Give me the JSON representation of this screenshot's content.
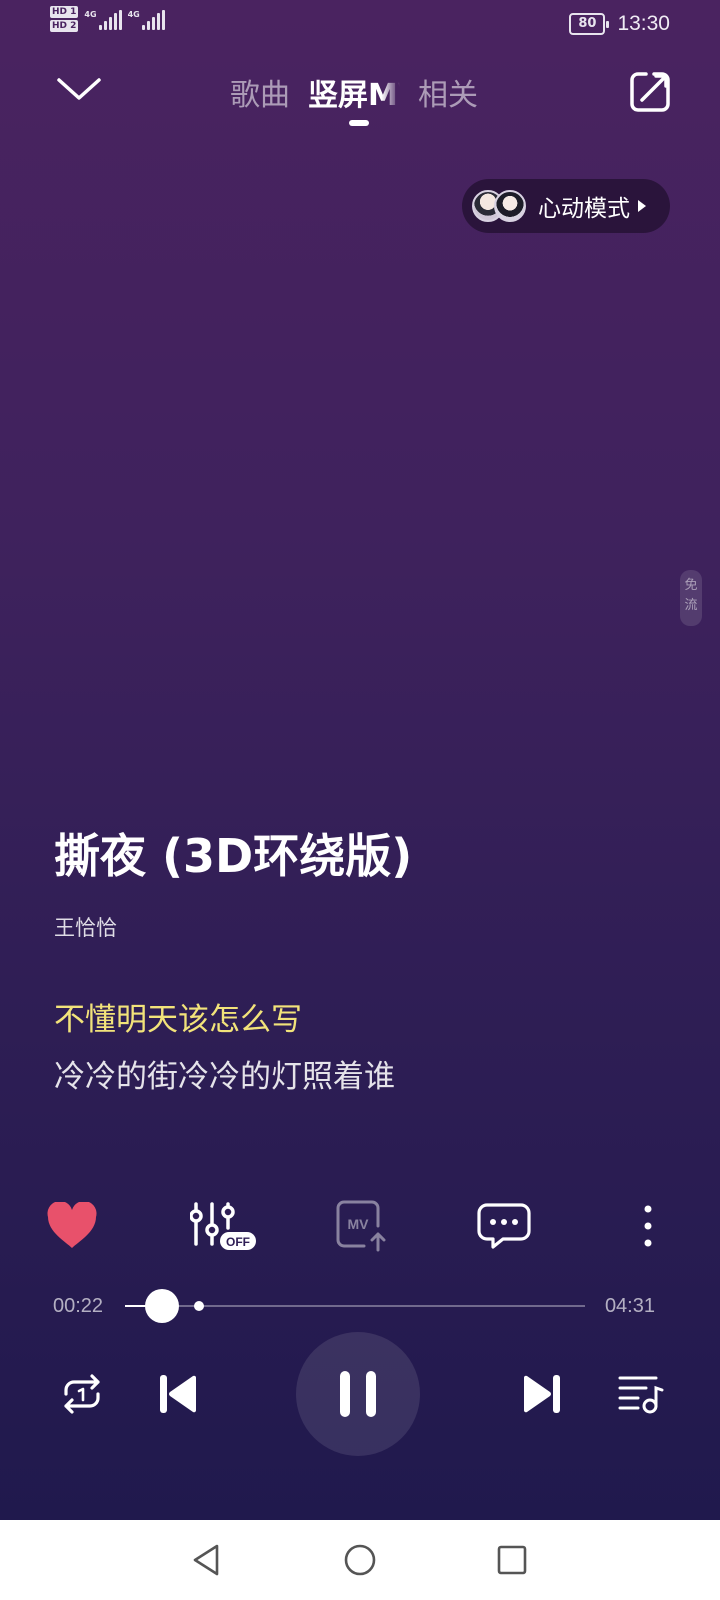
{
  "status_bar": {
    "sim1": "HD",
    "sim1_slot": "1",
    "sim2": "HD",
    "sim2_slot": "2",
    "network1": "4G",
    "network2": "4G",
    "battery": "80",
    "time": "13:30"
  },
  "header": {
    "tabs": [
      {
        "label": "歌曲",
        "active": false
      },
      {
        "label": "竖屏MV",
        "active": true
      },
      {
        "label": "相关",
        "active": false
      }
    ]
  },
  "heart_mode": {
    "label": "心动模式"
  },
  "side_tag": {
    "text": "免流"
  },
  "song": {
    "title": "撕夜 (3D环绕版)",
    "artist": "王恰恰"
  },
  "lyrics": {
    "current": "不懂明天该怎么写",
    "next": "冷冷的街冷冷的灯照着谁"
  },
  "actions": {
    "liked": true,
    "sound_effect_badge": "OFF",
    "mv_label": "MV"
  },
  "progress": {
    "current": "00:22",
    "total": "04:31",
    "fraction": 0.081,
    "buffered_fraction": 0.16
  },
  "colors": {
    "accent_like": "#e8516b",
    "lyric_highlight": "#f2e37a",
    "background_top": "#4a2360",
    "background_bottom": "#20194d"
  },
  "icons": {
    "collapse": "chevron-down-icon",
    "share": "share-icon",
    "like": "heart-icon",
    "sound_effect": "equalizer-icon",
    "mv": "mv-upload-icon",
    "comment": "comment-icon",
    "more": "more-vertical-icon",
    "loop": "repeat-one-icon",
    "previous": "previous-icon",
    "pause": "pause-icon",
    "next": "next-icon",
    "playlist": "playlist-icon"
  }
}
